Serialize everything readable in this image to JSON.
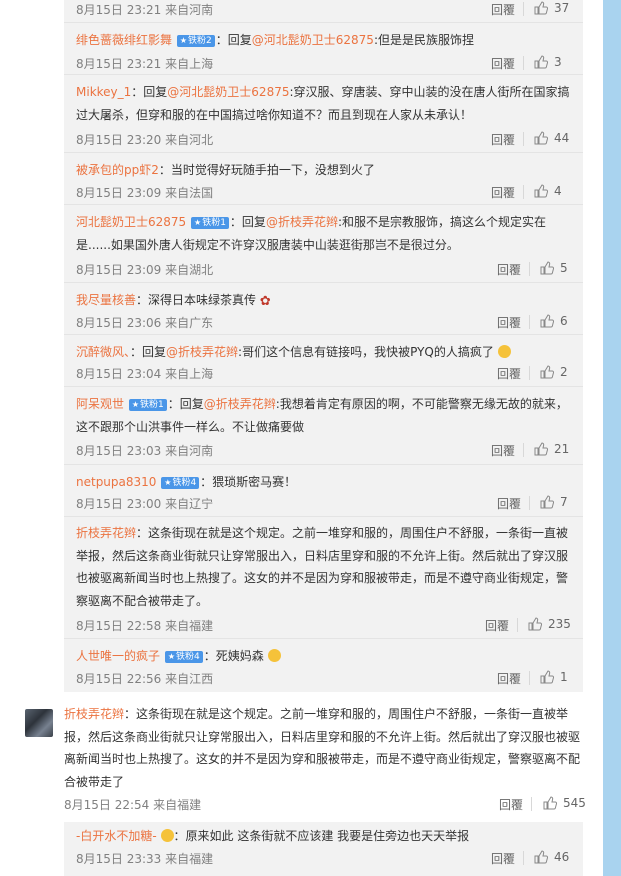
{
  "thread": {
    "replies": [
      {
        "user": "",
        "badge": "",
        "reply_to": "",
        "text": "",
        "time": "8月15日 23:21 来自河南",
        "likes": "37",
        "reply_label": "回覆"
      },
      {
        "user": "绯色蔷薇绯红影舞",
        "badge": "铁粉2",
        "prefix": "：回复",
        "reply_to": "@河北髭奶卫士62875",
        "text": ":但是是民族服饰捏",
        "time": "8月15日 23:21 来自上海",
        "likes": "3",
        "reply_label": "回覆"
      },
      {
        "user": "Mikkey_1",
        "badge": "",
        "prefix": "：回复",
        "reply_to": "@河北髭奶卫士62875",
        "text": ":穿汉服、穿唐装、穿中山装的没在唐人街所在国家搞过大屠杀，但穿和服的在中国搞过啥你知道不？而且到现在人家从未承认！",
        "time": "8月15日 23:20 来自河北",
        "likes": "44",
        "reply_label": "回覆"
      },
      {
        "user": "被承包的pp虾2",
        "badge": "",
        "prefix": "",
        "reply_to": "",
        "text": "：当时觉得好玩随手拍一下，没想到火了",
        "time": "8月15日 23:09 来自法国",
        "likes": "4",
        "reply_label": "回覆"
      },
      {
        "user": "河北髭奶卫士62875",
        "badge": "铁粉1",
        "prefix": "：回复",
        "reply_to": "@折枝弄花辫",
        "text": ":和服不是宗教服饰，搞这么个规定实在是......如果国外唐人街规定不许穿汉服唐装中山装逛街那岂不是很过分。",
        "time": "8月15日 23:09 来自湖北",
        "likes": "5",
        "reply_label": "回覆"
      },
      {
        "user": "我尽量核善",
        "badge": "",
        "prefix": "",
        "reply_to": "",
        "text": "：深得日本味绿茶真传",
        "time": "8月15日 23:06 来自广东",
        "likes": "6",
        "reply_label": "回覆"
      },
      {
        "user": "沉醉微风、",
        "badge": "",
        "prefix": "：回复",
        "reply_to": "@折枝弄花辫",
        "text": ":哥们这个信息有链接吗，我快被PYQ的人搞疯了",
        "time": "8月15日 23:04 来自上海",
        "likes": "2",
        "reply_label": "回覆"
      },
      {
        "user": "阿呆观世",
        "badge": "铁粉1",
        "prefix": "：回复",
        "reply_to": "@折枝弄花辫",
        "text": ":我想着肯定有原因的啊，不可能警察无缘无故的就来，这不跟那个山洪事件一样么。不让做痛要做",
        "time": "8月15日 23:03 来自河南",
        "likes": "21",
        "reply_label": "回覆"
      },
      {
        "user": "netpupa8310",
        "badge": "铁粉4",
        "prefix": "",
        "reply_to": "",
        "text": "：猥琐斯密马赛！",
        "time": "8月15日 23:00 来自辽宁",
        "likes": "7",
        "reply_label": "回覆"
      },
      {
        "user": "折枝弄花辫",
        "badge": "",
        "prefix": "",
        "reply_to": "",
        "text": "：这条街现在就是这个规定。之前一堆穿和服的，周围住户不舒服，一条街一直被举报，然后这条商业街就只让穿常服出入，日料店里穿和服的不允许上街。然后就出了穿汉服也被驱离新闻当时也上热搜了。这女的并不是因为穿和服被带走，而是不遵守商业街规定，警察驱离不配合被带走了。",
        "time": "8月15日 22:58 来自福建",
        "likes": "235",
        "reply_label": "回覆"
      },
      {
        "user": "人世唯一的疯子",
        "badge": "铁粉4",
        "prefix": "",
        "reply_to": "",
        "text": "：死姨妈森",
        "time": "8月15日 22:56 来自江西",
        "likes": "1",
        "reply_label": "回覆"
      }
    ],
    "main": {
      "user": "折枝弄花辫",
      "text": "：这条街现在就是这个规定。之前一堆穿和服的，周围住户不舒服，一条街一直被举报，然后这条商业街就只让穿常服出入，日料店里穿和服的不允许上街。然后就出了穿汉服也被驱离新闻当时也上热搜了。这女的并不是因为穿和服被带走，而是不遵守商业街规定，警察驱离不配合被带走了",
      "time": "8月15日 22:54 来自福建",
      "likes": "545",
      "reply_label": "回覆"
    },
    "sub": {
      "user": "-白开水不加糖-",
      "text": "：原来如此 这条街就不应该建 我要是住旁边也天天举报",
      "time": "8月15日 23:33 来自福建",
      "likes": "46",
      "reply_label": "回覆"
    }
  },
  "colors": {
    "username": "#eb7340",
    "badge": "#4a96e8",
    "meta": "#808080",
    "scrollbar": "#a9d3ef",
    "reply_bg": "#f2f2f2"
  },
  "icons": {
    "like": "thumbs-up-icon",
    "badge_star": "star-icon"
  }
}
